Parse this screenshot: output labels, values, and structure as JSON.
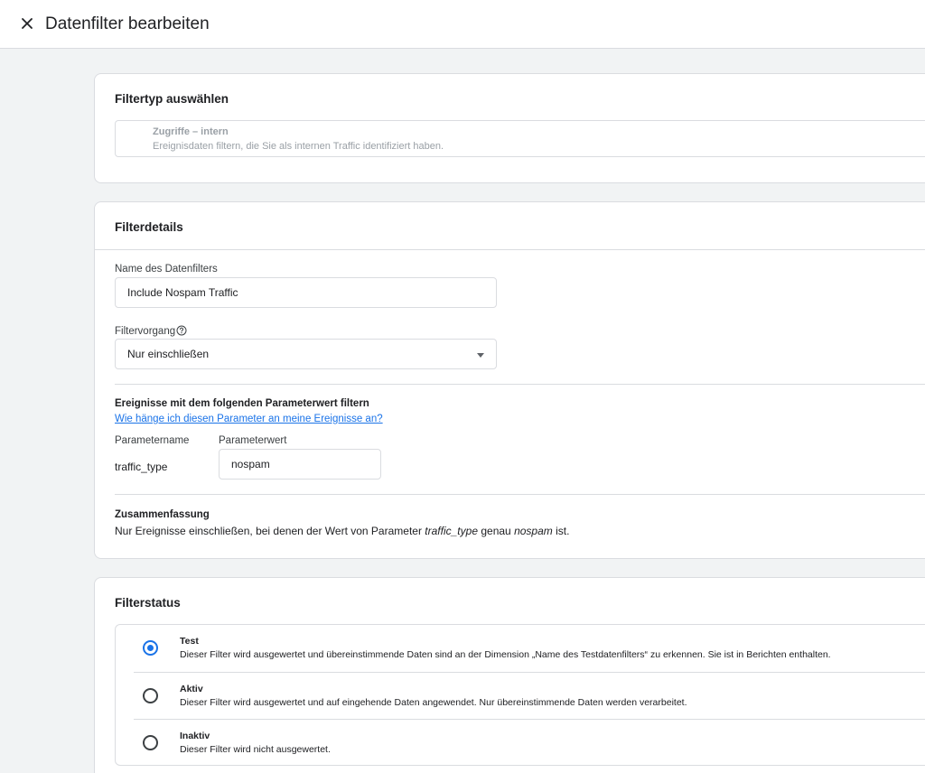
{
  "header": {
    "title": "Datenfilter bearbeiten",
    "close_icon": "close-icon"
  },
  "filter_type": {
    "title": "Filtertyp auswählen",
    "selected_name": "Zugriffe – intern",
    "selected_description": "Ereignisdaten filtern, die Sie als internen Traffic identifiziert haben."
  },
  "details": {
    "title": "Filterdetails",
    "name_label": "Name des Datenfilters",
    "name_value": "Include Nospam Traffic",
    "operation_label": "Filtervorgang",
    "operation_value": "Nur einschließen",
    "help_icon": "help-circle-icon",
    "param_heading": "Ereignisse mit dem folgenden Parameterwert filtern",
    "param_link": "Wie hänge ich diesen Parameter an meine Ereignisse an?",
    "param_name_header": "Parametername",
    "param_value_header": "Parameterwert",
    "param_name": "traffic_type",
    "param_value": "nospam",
    "summary_heading": "Zusammenfassung",
    "summary_prefix": "Nur Ereignisse einschließen, bei denen der Wert von Parameter",
    "summary_param": "traffic_type",
    "summary_mid": "genau",
    "summary_value": "nospam",
    "summary_suffix": "ist."
  },
  "status": {
    "title": "Filterstatus",
    "selected": "test",
    "options": [
      {
        "id": "test",
        "label": "Test",
        "description": "Dieser Filter wird ausgewertet und übereinstimmende Daten sind an der Dimension „Name des Testdatenfilters“ zu erkennen. Sie ist in Berichten enthalten."
      },
      {
        "id": "aktiv",
        "label": "Aktiv",
        "description": "Dieser Filter wird ausgewertet und auf eingehende Daten angewendet. Nur übereinstimmende Daten werden verarbeitet."
      },
      {
        "id": "inaktiv",
        "label": "Inaktiv",
        "description": "Dieser Filter wird nicht ausgewertet."
      }
    ]
  },
  "colors": {
    "accent": "#1a73e8",
    "background": "#f1f3f4",
    "border": "#dadce0"
  }
}
